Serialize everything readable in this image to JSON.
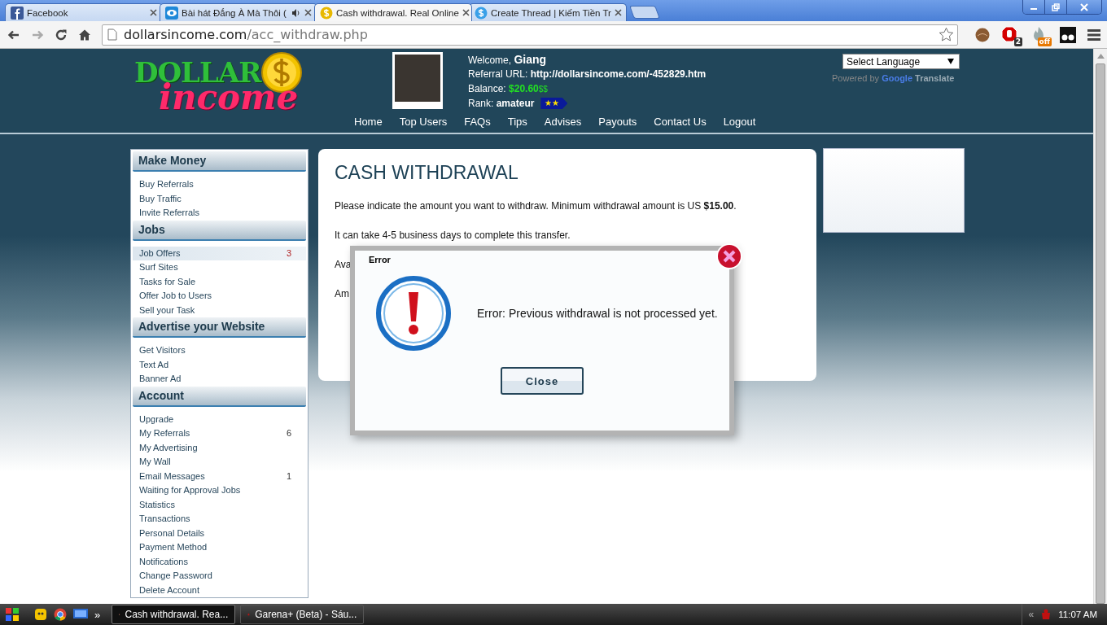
{
  "browser": {
    "tabs": [
      {
        "title": "Facebook",
        "selected": false,
        "audio": false
      },
      {
        "title": "Bài hát Đắng À Mà Thôi (",
        "selected": false,
        "audio": true
      },
      {
        "title": "Cash withdrawal. Real Online",
        "selected": true,
        "audio": false
      },
      {
        "title": "Create Thread | Kiếm Tiền Tr",
        "selected": false,
        "audio": false
      }
    ],
    "address": {
      "host": "dollarsincome.com",
      "path": "/acc_withdraw.php"
    },
    "extensions": [
      {
        "kind": "avatar"
      },
      {
        "kind": "adblock",
        "badge": "2"
      },
      {
        "kind": "flame",
        "badge": "off"
      },
      {
        "kind": "glasses"
      }
    ]
  },
  "header": {
    "logo": {
      "top": "DOLLAR",
      "bottom": "income"
    },
    "user": {
      "welcome_label": "Welcome,",
      "name": "Giang",
      "referral_label": "Referral URL:",
      "referral_url": "http://dollarsincome.com/-452829.htm",
      "balance_label": "Balance:",
      "balance": "$20.60",
      "balance_unit": "$$",
      "rank_label": "Rank:",
      "rank": "amateur",
      "rank_badge": "★★"
    },
    "nav": [
      "Home",
      "Top Users",
      "FAQs",
      "Tips",
      "Advises",
      "Payouts",
      "Contact Us",
      "Logout"
    ],
    "language": {
      "select": "Select Language",
      "powered_by": "Powered by",
      "google": "Google",
      "translate": "Translate"
    }
  },
  "sidebar": [
    {
      "title": "Make Money",
      "items": [
        {
          "label": "Buy Referrals",
          "selected": false
        },
        {
          "label": "Buy Traffic",
          "selected": false
        },
        {
          "label": "Invite Referrals",
          "selected": false
        }
      ]
    },
    {
      "title": "Jobs",
      "items": [
        {
          "label": "Job Offers",
          "count": "3",
          "selected": true
        },
        {
          "label": "Surf Sites",
          "selected": false
        },
        {
          "label": "Tasks for Sale",
          "selected": false
        },
        {
          "label": "Offer Job to Users",
          "selected": false
        },
        {
          "label": "Sell your Task",
          "selected": false
        }
      ]
    },
    {
      "title": "Advertise your Website",
      "items": [
        {
          "label": "Get Visitors",
          "selected": false
        },
        {
          "label": "Text Ad",
          "selected": false
        },
        {
          "label": "Banner Ad",
          "selected": false
        }
      ]
    },
    {
      "title": "Account",
      "items": [
        {
          "label": "Upgrade",
          "selected": false
        },
        {
          "label": "My Referrals",
          "count": "6",
          "selected": false
        },
        {
          "label": "My Advertising",
          "selected": false
        },
        {
          "label": "My Wall",
          "selected": false
        },
        {
          "label": "Email Messages",
          "count": "1",
          "selected": false
        },
        {
          "label": "Waiting for Approval Jobs",
          "selected": false
        },
        {
          "label": "Statistics",
          "selected": false
        },
        {
          "label": "Transactions",
          "selected": false
        },
        {
          "label": "Personal Details",
          "selected": false
        },
        {
          "label": "Payment Method",
          "selected": false
        },
        {
          "label": "Notifications",
          "selected": false
        },
        {
          "label": "Change Password",
          "selected": false
        },
        {
          "label": "Delete Account",
          "selected": false
        }
      ]
    }
  ],
  "main": {
    "title": "CASH WITHDRAWAL",
    "intro": "Please indicate the amount you want to withdraw. Minimum withdrawal amount is US **$15.00**.",
    "note": "It can take 4-5 business days to complete this transfer.",
    "available_visible": "Ava",
    "amount_visible": "Am"
  },
  "dialog": {
    "title": "Error",
    "message": "Error: Previous withdrawal is not processed yet.",
    "button": "Close"
  },
  "taskbar": {
    "more": "»",
    "windows": [
      {
        "title": "Cash withdrawal. Rea...",
        "selected": true
      },
      {
        "title": "Garena+ (Beta) - Sáu...",
        "selected": false
      }
    ],
    "tray_arrow": "«",
    "clock": "11:07 AM"
  }
}
